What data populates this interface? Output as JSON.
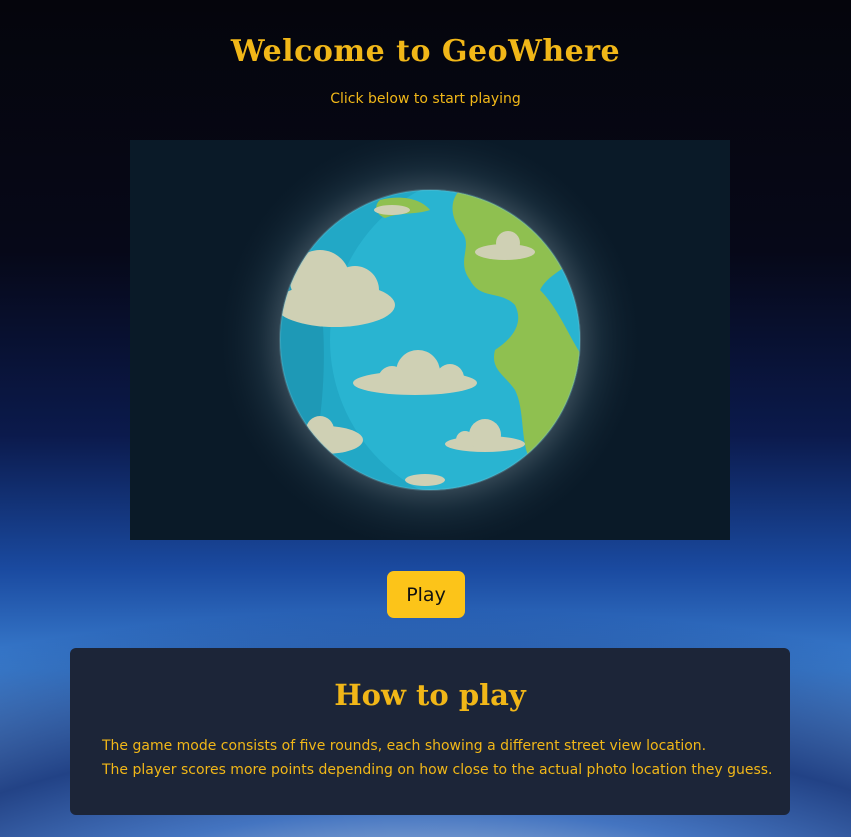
{
  "header": {
    "title": "Welcome to GeoWhere",
    "subtitle": "Click below to start playing"
  },
  "hero": {
    "image": "earth-globe-illustration",
    "colors": {
      "ocean": "#22a8c6",
      "land": "#8fc050",
      "cloud": "#cfd0b4",
      "background": "#0a1a28"
    }
  },
  "play_button": {
    "label": "Play",
    "color": "#fcc419"
  },
  "how_to_play": {
    "title": "How to play",
    "lines": [
      "The game mode consists of five rounds, each showing a different street view location.",
      "The player scores more points depending on how close to the actual photo location they guess."
    ]
  },
  "colors": {
    "accent": "#f1b718",
    "panel": "#1c2538"
  }
}
